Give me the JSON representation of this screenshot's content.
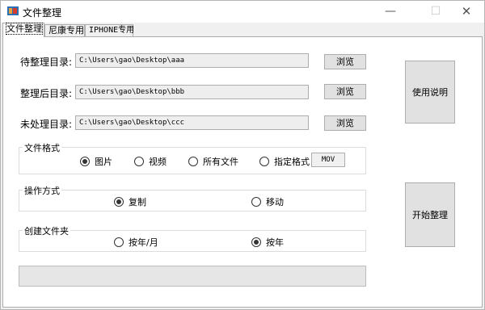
{
  "window": {
    "title": "文件整理",
    "minimize_glyph": "—",
    "maximize_glyph": "☐",
    "close_glyph": "✕",
    "icon": "folder-app-icon"
  },
  "tabs": [
    {
      "label": "文件整理",
      "active": true
    },
    {
      "label": "尼康专用",
      "active": false
    },
    {
      "label": "IPHONE专用",
      "active": false
    }
  ],
  "directories": [
    {
      "label": "待整理目录:",
      "value": "C:\\Users\\gao\\Desktop\\aaa",
      "browse_label": "浏览"
    },
    {
      "label": "整理后目录:",
      "value": "C:\\Users\\gao\\Desktop\\bbb",
      "browse_label": "浏览"
    },
    {
      "label": "未处理目录:",
      "value": "C:\\Users\\gao\\Desktop\\ccc",
      "browse_label": "浏览"
    }
  ],
  "file_format": {
    "legend": "文件格式",
    "options": [
      {
        "label": "图片",
        "checked": true
      },
      {
        "label": "视频",
        "checked": false
      },
      {
        "label": "所有文件",
        "checked": false
      },
      {
        "label": "指定格式",
        "checked": false
      }
    ],
    "specified_value": "MOV"
  },
  "operation": {
    "legend": "操作方式",
    "options": [
      {
        "label": "复制",
        "checked": true
      },
      {
        "label": "移动",
        "checked": false
      }
    ]
  },
  "create_folder": {
    "legend": "创建文件夹",
    "options": [
      {
        "label": "按年/月",
        "checked": false
      },
      {
        "label": "按年",
        "checked": true
      }
    ]
  },
  "buttons": {
    "instructions": "使用说明",
    "start": "开始整理"
  },
  "progress": {
    "value": 0
  }
}
